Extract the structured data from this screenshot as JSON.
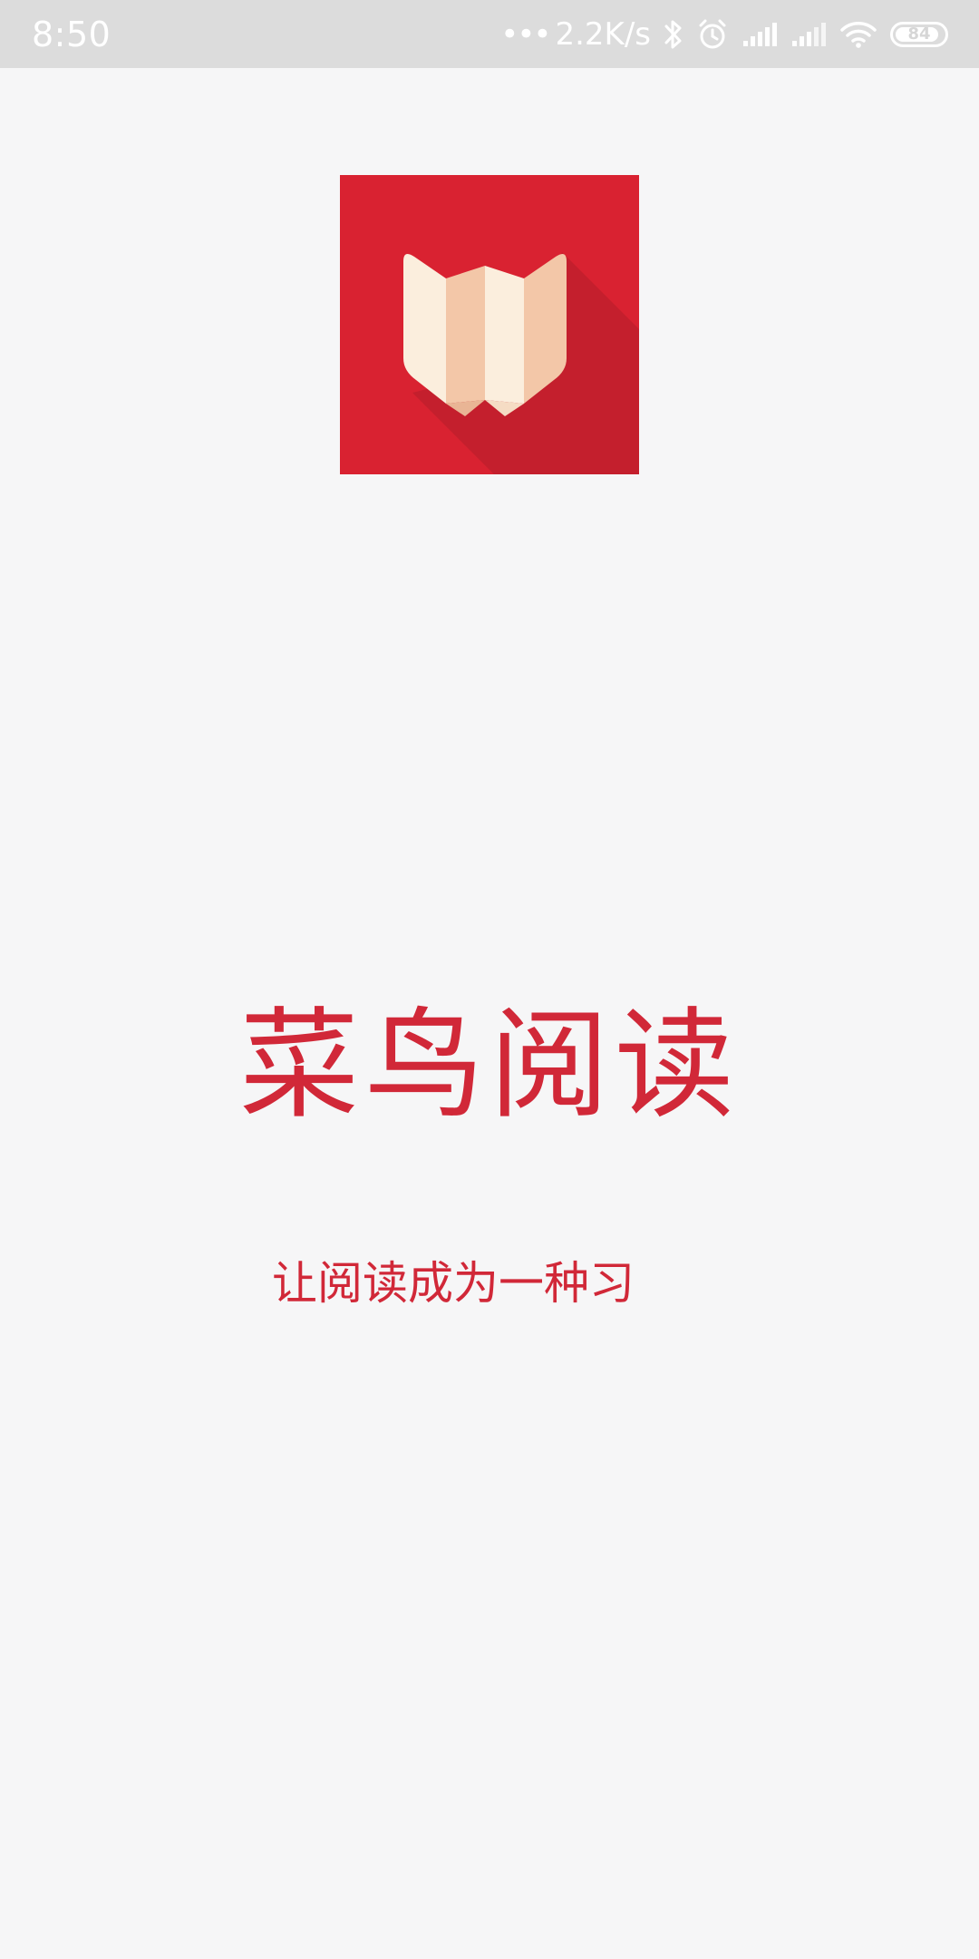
{
  "status_bar": {
    "time": "8:50",
    "network_dots": "•••",
    "network_speed": "2.2K/s",
    "battery_level": "84",
    "icons": [
      "bluetooth-icon",
      "alarm-icon",
      "signal-icon",
      "signal-icon",
      "wifi-icon",
      "battery-icon"
    ]
  },
  "splash": {
    "logo_icon": "open-book-icon",
    "title": "菜鸟阅读",
    "slogan": "让阅读成为一种习"
  },
  "colors": {
    "brand_red": "#d92231",
    "text_red": "#d12838",
    "background": "#f6f6f7",
    "status_bar_bg": "#dcdcdc"
  }
}
